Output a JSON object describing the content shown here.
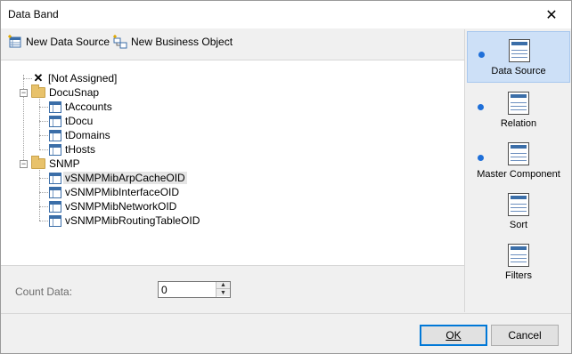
{
  "window": {
    "title": "Data Band"
  },
  "toolbar": {
    "new_data_source": "New Data Source",
    "new_business_object": "New Business Object"
  },
  "tree": {
    "not_assigned": "[Not Assigned]",
    "groups": [
      {
        "label": "DocuSnap",
        "items": [
          "tAccounts",
          "tDocu",
          "tDomains",
          "tHosts"
        ]
      },
      {
        "label": "SNMP",
        "items": [
          "vSNMPMibArpCacheOID",
          "vSNMPMibInterfaceOID",
          "vSNMPMibNetworkOID",
          "vSNMPMibRoutingTableOID"
        ]
      }
    ],
    "selected": "vSNMPMibArpCacheOID"
  },
  "count": {
    "label": "Count Data:",
    "value": "0"
  },
  "sidebar": {
    "items": [
      {
        "label": "Data Source",
        "active": true,
        "bullet": true
      },
      {
        "label": "Relation",
        "active": false,
        "bullet": true
      },
      {
        "label": "Master Component",
        "active": false,
        "bullet": true
      },
      {
        "label": "Sort",
        "active": false,
        "bullet": false
      },
      {
        "label": "Filters",
        "active": false,
        "bullet": false
      }
    ]
  },
  "buttons": {
    "ok": "OK",
    "cancel": "Cancel"
  },
  "colors": {
    "accent": "#1e6fd9",
    "active_bg": "#cde0f7",
    "folder": "#e8c26b",
    "table_icon": "#3b6ea8"
  }
}
